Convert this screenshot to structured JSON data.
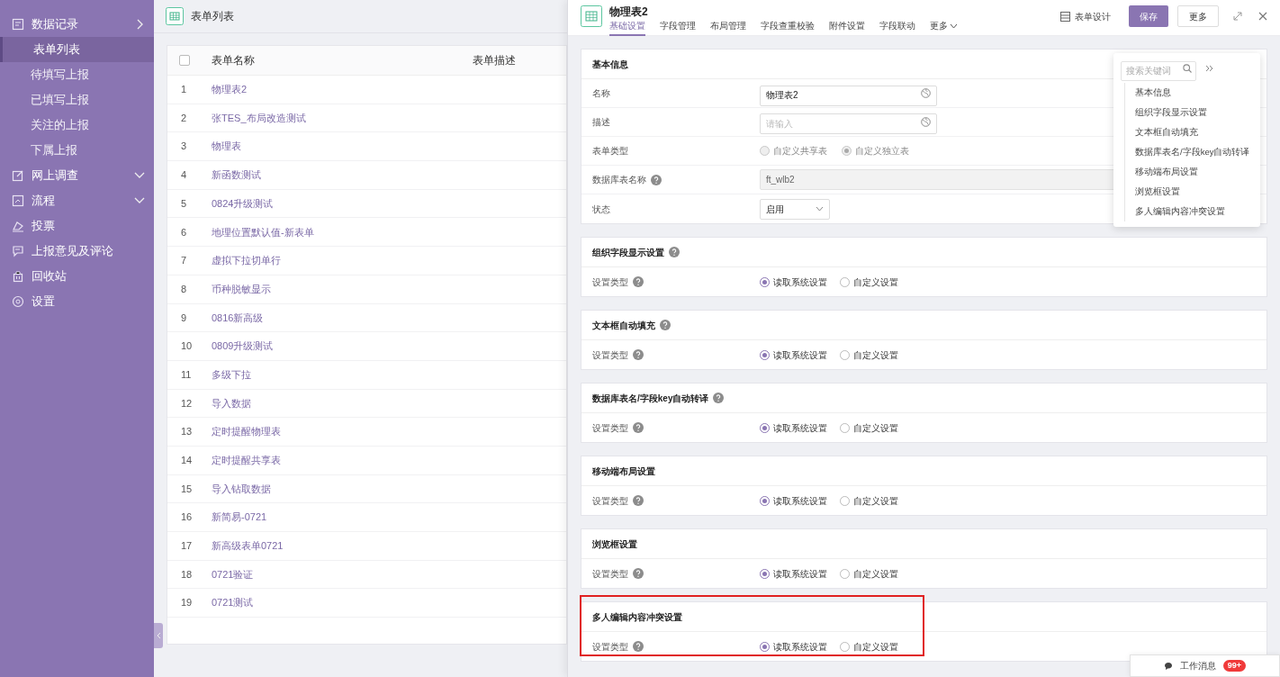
{
  "sidebar": {
    "items": [
      {
        "label": "数据记录",
        "chevron_down": false,
        "children": [
          {
            "label": "表单列表",
            "selected": true
          },
          {
            "label": "待填写上报",
            "selected": false
          },
          {
            "label": "已填写上报",
            "selected": false
          },
          {
            "label": "关注的上报",
            "selected": false
          },
          {
            "label": "下属上报",
            "selected": false
          }
        ]
      },
      {
        "label": "网上调查",
        "chevron_down": true
      },
      {
        "label": "流程",
        "chevron_down": true
      },
      {
        "label": "投票"
      },
      {
        "label": "上报意见及评论"
      },
      {
        "label": "回收站"
      },
      {
        "label": "设置"
      }
    ]
  },
  "list_panel": {
    "title": "表单列表",
    "table": {
      "columns": [
        "表单名称",
        "表单描述"
      ],
      "select_all_checked": false,
      "rows": [
        {
          "index": "1",
          "name": "物理表2"
        },
        {
          "index": "2",
          "name": "张TES_布局改造测试"
        },
        {
          "index": "3",
          "name": "物理表"
        },
        {
          "index": "4",
          "name": "新函数测试"
        },
        {
          "index": "5",
          "name": "0824升级测试"
        },
        {
          "index": "6",
          "name": "地理位置默认值-新表单"
        },
        {
          "index": "7",
          "name": "虚拟下拉切单行"
        },
        {
          "index": "8",
          "name": "币种脱敏显示"
        },
        {
          "index": "9",
          "name": "0816新高级"
        },
        {
          "index": "10",
          "name": "0809升级测试"
        },
        {
          "index": "11",
          "name": "多级下拉"
        },
        {
          "index": "12",
          "name": "导入数据"
        },
        {
          "index": "13",
          "name": "定时提醒物理表"
        },
        {
          "index": "14",
          "name": "定时提醒共享表"
        },
        {
          "index": "15",
          "name": "导入钻取数据"
        },
        {
          "index": "16",
          "name": "新简易-0721"
        },
        {
          "index": "17",
          "name": "新高级表单0721"
        },
        {
          "index": "18",
          "name": "0721验证"
        },
        {
          "index": "19",
          "name": "0721测试"
        }
      ]
    }
  },
  "detail": {
    "title": "物理表2",
    "tabs": [
      {
        "label": "基础设置",
        "selected": true
      },
      {
        "label": "字段管理",
        "selected": false
      },
      {
        "label": "布局管理",
        "selected": false
      },
      {
        "label": "字段查重校验",
        "selected": false
      },
      {
        "label": "附件设置",
        "selected": false
      },
      {
        "label": "字段联动",
        "selected": false
      },
      {
        "label": "更多",
        "selected": false,
        "dropdown": true
      }
    ],
    "actions": {
      "design": "表单设计",
      "save": "保存",
      "more": "更多"
    },
    "basic_info": {
      "title": "基本信息",
      "fields": [
        {
          "kind": "input",
          "label": "名称",
          "value": "物理表2"
        },
        {
          "kind": "input",
          "label": "描述",
          "placeholder": "请输入"
        },
        {
          "kind": "radio",
          "label": "表单类型",
          "disabled": true,
          "options": [
            {
              "label": "自定义共享表",
              "selected": false
            },
            {
              "label": "自定义独立表",
              "selected": true
            }
          ]
        },
        {
          "kind": "readonly",
          "label": "数据库表名称",
          "help": true,
          "value": "ft_wlb2"
        },
        {
          "kind": "select",
          "label": "状态",
          "value": "启用"
        }
      ]
    },
    "sections": [
      {
        "title": "组织字段显示设置",
        "help": true,
        "highlighted": false,
        "label": "设置类型",
        "options": [
          {
            "label": "读取系统设置",
            "selected": true
          },
          {
            "label": "自定义设置",
            "selected": false
          }
        ]
      },
      {
        "title": "文本框自动填充",
        "help": true,
        "highlighted": false,
        "label": "设置类型",
        "options": [
          {
            "label": "读取系统设置",
            "selected": true
          },
          {
            "label": "自定义设置",
            "selected": false
          }
        ]
      },
      {
        "title": "数据库表名/字段key自动转译",
        "help": true,
        "highlighted": false,
        "label": "设置类型",
        "options": [
          {
            "label": "读取系统设置",
            "selected": true
          },
          {
            "label": "自定义设置",
            "selected": false
          }
        ]
      },
      {
        "title": "移动端布局设置",
        "help": false,
        "highlighted": false,
        "label": "设置类型",
        "options": [
          {
            "label": "读取系统设置",
            "selected": true
          },
          {
            "label": "自定义设置",
            "selected": false
          }
        ]
      },
      {
        "title": "浏览框设置",
        "help": false,
        "highlighted": false,
        "label": "设置类型",
        "options": [
          {
            "label": "读取系统设置",
            "selected": true
          },
          {
            "label": "自定义设置",
            "selected": false
          }
        ]
      },
      {
        "title": "多人编辑内容冲突设置",
        "help": false,
        "highlighted": true,
        "label": "设置类型",
        "options": [
          {
            "label": "读取系统设置",
            "selected": true
          },
          {
            "label": "自定义设置",
            "selected": false
          }
        ]
      }
    ],
    "anchor_nav": {
      "search_placeholder": "搜索关键词",
      "items": [
        "基本信息",
        "组织字段显示设置",
        "文本框自动填充",
        "数据库表名/字段key自动转译",
        "移动端布局设置",
        "浏览框设置",
        "多人编辑内容冲突设置"
      ]
    }
  },
  "work_message": {
    "label": "工作消息",
    "badge": "99+"
  }
}
